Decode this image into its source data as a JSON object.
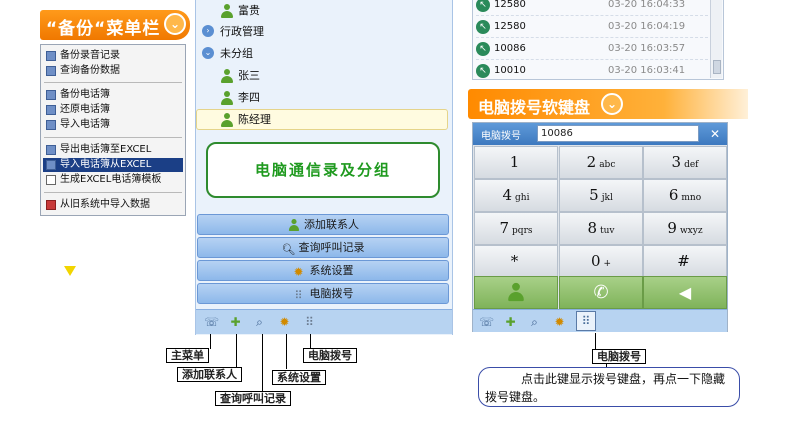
{
  "left_banner": {
    "title": "“备份“菜单栏"
  },
  "backup_menu": {
    "items": [
      {
        "label": "备份录音记录"
      },
      {
        "label": "查询备份数据"
      },
      {
        "label": "备份电话簿"
      },
      {
        "label": "还原电话簿"
      },
      {
        "label": "导入电话簿"
      },
      {
        "label": "导出电话簿至EXCEL"
      },
      {
        "label": "导入电话簿从EXCEL"
      },
      {
        "label": "生成EXCEL电话簿模板"
      },
      {
        "label": "从旧系统中导入数据"
      }
    ],
    "selected_index": 6
  },
  "contacts_tree": {
    "rows": [
      {
        "label": "富贵",
        "type": "contact"
      },
      {
        "label": "行政管理",
        "type": "group-collapsed"
      },
      {
        "label": "未分组",
        "type": "group-expanded"
      },
      {
        "label": "张三",
        "type": "contact"
      },
      {
        "label": "李四",
        "type": "contact"
      },
      {
        "label": "陈经理",
        "type": "contact",
        "selected": true
      }
    ]
  },
  "callout_box": {
    "text": "电脑通信录及分组"
  },
  "nav_buttons": [
    {
      "label": "添加联系人",
      "icon": "add-contact-icon"
    },
    {
      "label": "查询呼叫记录",
      "icon": "search-icon"
    },
    {
      "label": "系统设置",
      "icon": "gear-icon"
    },
    {
      "label": "电脑拨号",
      "icon": "dialpad-icon"
    }
  ],
  "call_log": [
    {
      "number": "12580",
      "time": "03-20 16:04:33"
    },
    {
      "number": "12580",
      "time": "03-20 16:04:19"
    },
    {
      "number": "10086",
      "time": "03-20 16:03:57"
    },
    {
      "number": "10010",
      "time": "03-20 16:03:41"
    }
  ],
  "right_banner": {
    "title": "电脑拨号软键盘"
  },
  "keypad": {
    "header_label": "电脑拨号",
    "input_value": "10086",
    "close_glyph": "✕",
    "keys": [
      {
        "main": "1",
        "sub": ""
      },
      {
        "main": "2",
        "sub": "abc"
      },
      {
        "main": "3",
        "sub": "def"
      },
      {
        "main": "4",
        "sub": "ghi"
      },
      {
        "main": "5",
        "sub": "jkl"
      },
      {
        "main": "6",
        "sub": "mno"
      },
      {
        "main": "7",
        "sub": "pqrs"
      },
      {
        "main": "8",
        "sub": "tuv"
      },
      {
        "main": "9",
        "sub": "wxyz"
      },
      {
        "main": "*",
        "sub": ""
      },
      {
        "main": "0",
        "sub": "+"
      },
      {
        "main": "#",
        "sub": ""
      }
    ]
  },
  "annotations": {
    "main_menu": "主菜单",
    "add_contact": "添加联系人",
    "query_calls": "查询呼叫记录",
    "system_settings": "系统设置",
    "pc_dial_left": "电脑拨号",
    "pc_dial_right": "电脑拨号",
    "note": "点击此键显示拨号键盘，再点一下隐藏拨号键盘。"
  },
  "colors": {
    "banner_orange": "#f07800",
    "selection_blue": "#1b3f86",
    "nav_blue": "#8db8ea",
    "callout_green": "#2e8b2e"
  }
}
